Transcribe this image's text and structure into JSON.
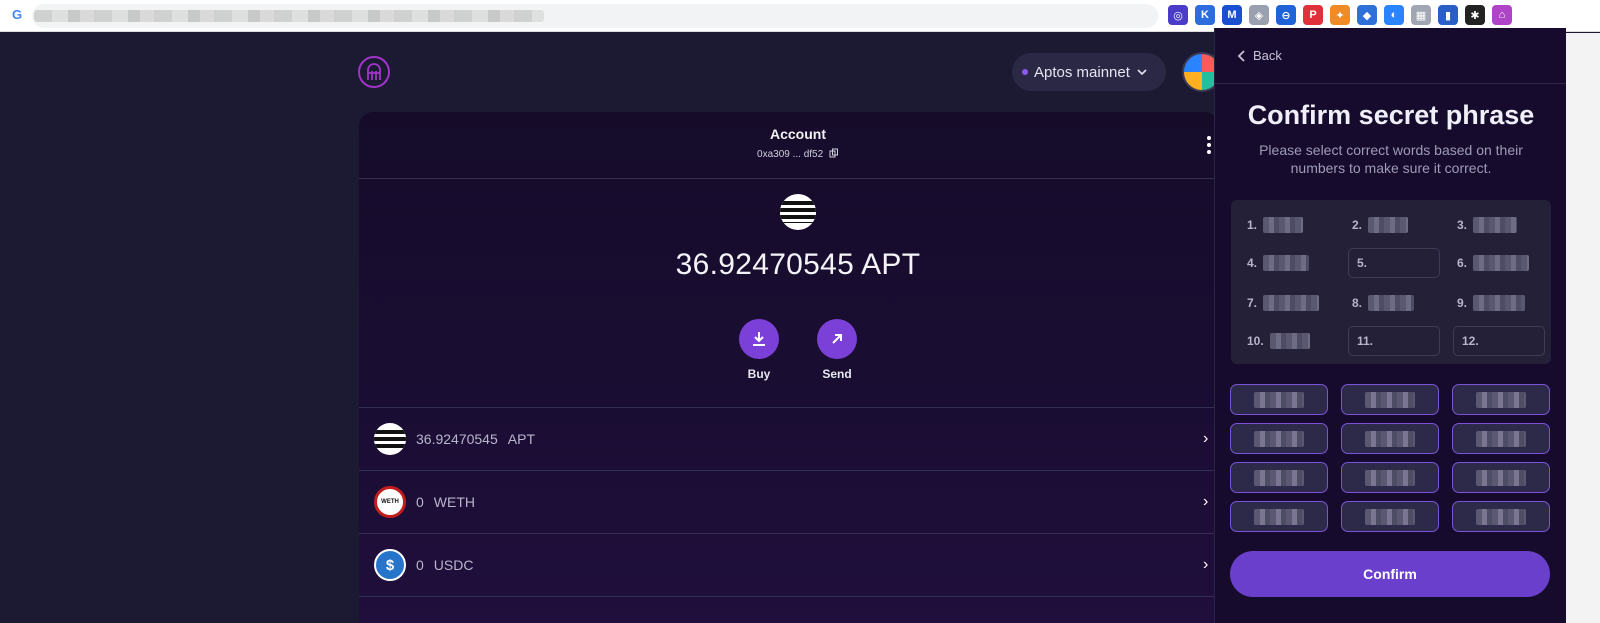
{
  "browser": {
    "google_glyph": "G",
    "extensions": [
      {
        "icon": "circle-ext-icon",
        "color": "#4a3cc9",
        "glyph": "◎"
      },
      {
        "icon": "k-ext-icon",
        "color": "#2d6cdf",
        "glyph": "K"
      },
      {
        "icon": "m-ext-icon",
        "color": "#1a4fd0",
        "glyph": "M"
      },
      {
        "icon": "shield-ext-icon",
        "color": "#9aa0b0",
        "glyph": "◈"
      },
      {
        "icon": "minus-circle-ext-icon",
        "color": "#1f63d8",
        "glyph": "⊖"
      },
      {
        "icon": "p-ext-icon",
        "color": "#e0303a",
        "glyph": "P"
      },
      {
        "icon": "fox-ext-icon",
        "color": "#f08a24",
        "glyph": "✦"
      },
      {
        "icon": "layers-ext-icon",
        "color": "#2f6fd8",
        "glyph": "◆"
      },
      {
        "icon": "swirl-ext-icon",
        "color": "#2a84ff",
        "glyph": "◐"
      },
      {
        "icon": "book-ext-icon",
        "color": "#a0a6b2",
        "glyph": "▦"
      },
      {
        "icon": "bookmark-ext-icon",
        "color": "#2a5fc8",
        "glyph": "▮"
      },
      {
        "icon": "puzzle-ext-icon",
        "color": "#222222",
        "glyph": "✱"
      },
      {
        "icon": "wallet-ext-icon",
        "color": "#b044c8",
        "glyph": "⌂"
      }
    ]
  },
  "header": {
    "network": "Aptos mainnet"
  },
  "account": {
    "title": "Account",
    "address": "0xa309 ... df52"
  },
  "balance": {
    "amount": "36.92470545 APT"
  },
  "actions": {
    "buy": "Buy",
    "send": "Send"
  },
  "tokens": [
    {
      "amount": "36.92470545",
      "symbol": "APT"
    },
    {
      "amount": "0",
      "symbol": "WETH"
    },
    {
      "amount": "0",
      "symbol": "USDC"
    }
  ],
  "weth_badge": "WETH",
  "usdc_badge": "$",
  "panel": {
    "back": "Back",
    "title": "Confirm secret phrase",
    "subtitle": "Please select correct words based on their numbers to make sure it correct.",
    "slots": [
      "1.",
      "2.",
      "3.",
      "4.",
      "5.",
      "6.",
      "7.",
      "8.",
      "9.",
      "10.",
      "11.",
      "12."
    ],
    "confirm": "Confirm"
  }
}
